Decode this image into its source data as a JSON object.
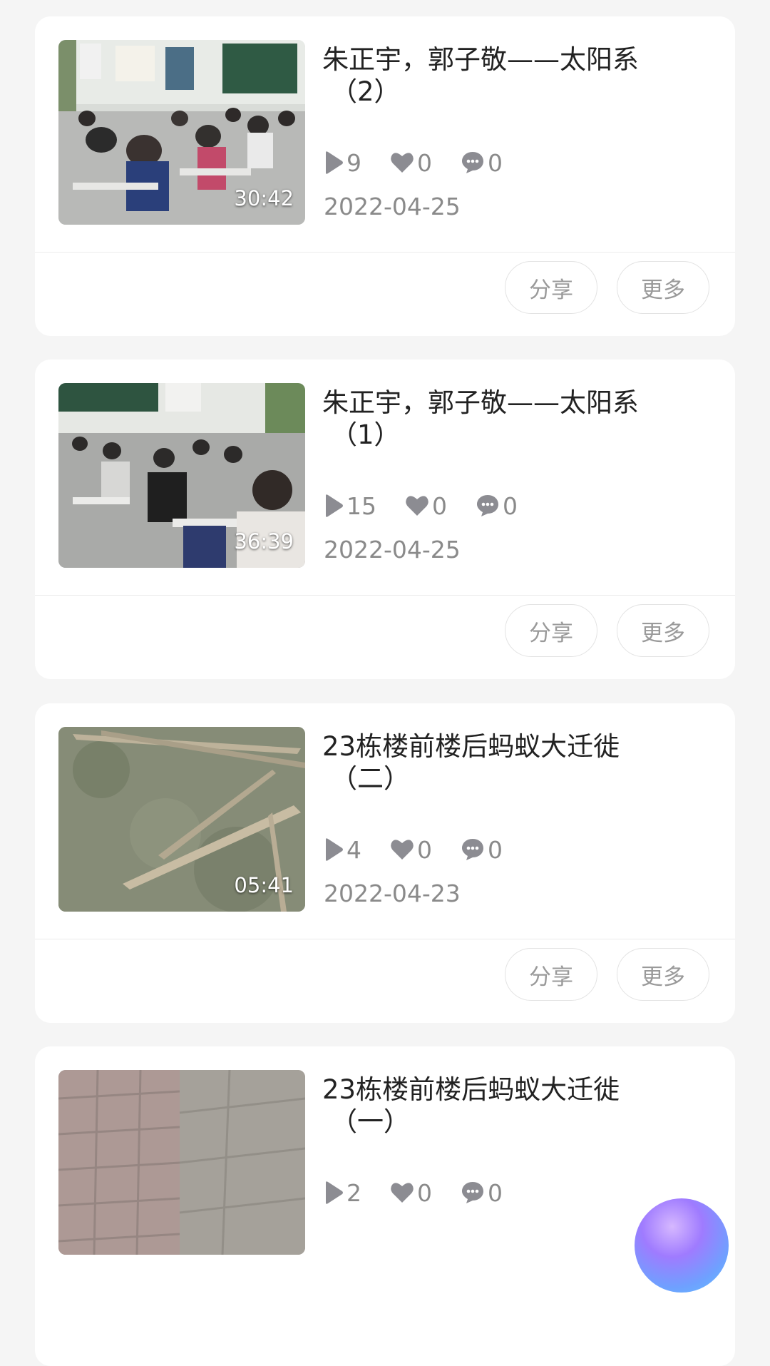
{
  "videos": [
    {
      "title_line1": "朱正宇，郭子敬——太阳系",
      "title_line2": "（2）",
      "duration": "30:42",
      "plays": "9",
      "likes": "0",
      "comments": "0",
      "date": "2022-04-25",
      "thumbnail": "classroom"
    },
    {
      "title_line1": "朱正宇，郭子敬——太阳系",
      "title_line2": "（1）",
      "duration": "36:39",
      "plays": "15",
      "likes": "0",
      "comments": "0",
      "date": "2022-04-25",
      "thumbnail": "classroom-2"
    },
    {
      "title_line1": "23栋楼前楼后蚂蚁大迁徙",
      "title_line2": "（二）",
      "duration": "05:41",
      "plays": "4",
      "likes": "0",
      "comments": "0",
      "date": "2022-04-23",
      "thumbnail": "ground-leaves"
    },
    {
      "title_line1": "23栋楼前楼后蚂蚁大迁徙",
      "title_line2": "（一）",
      "duration": "",
      "plays": "2",
      "likes": "0",
      "comments": "0",
      "date": "",
      "thumbnail": "pavement"
    }
  ],
  "actions": {
    "share_label": "分享",
    "more_label": "更多"
  },
  "icons": {
    "plays": "play-icon",
    "likes": "heart-icon",
    "comments": "comment-icon"
  },
  "colors": {
    "background": "#f5f5f5",
    "card": "#ffffff",
    "title_text": "#222222",
    "meta_text": "#8a8a8a",
    "icon_gray": "#8c8c92"
  }
}
